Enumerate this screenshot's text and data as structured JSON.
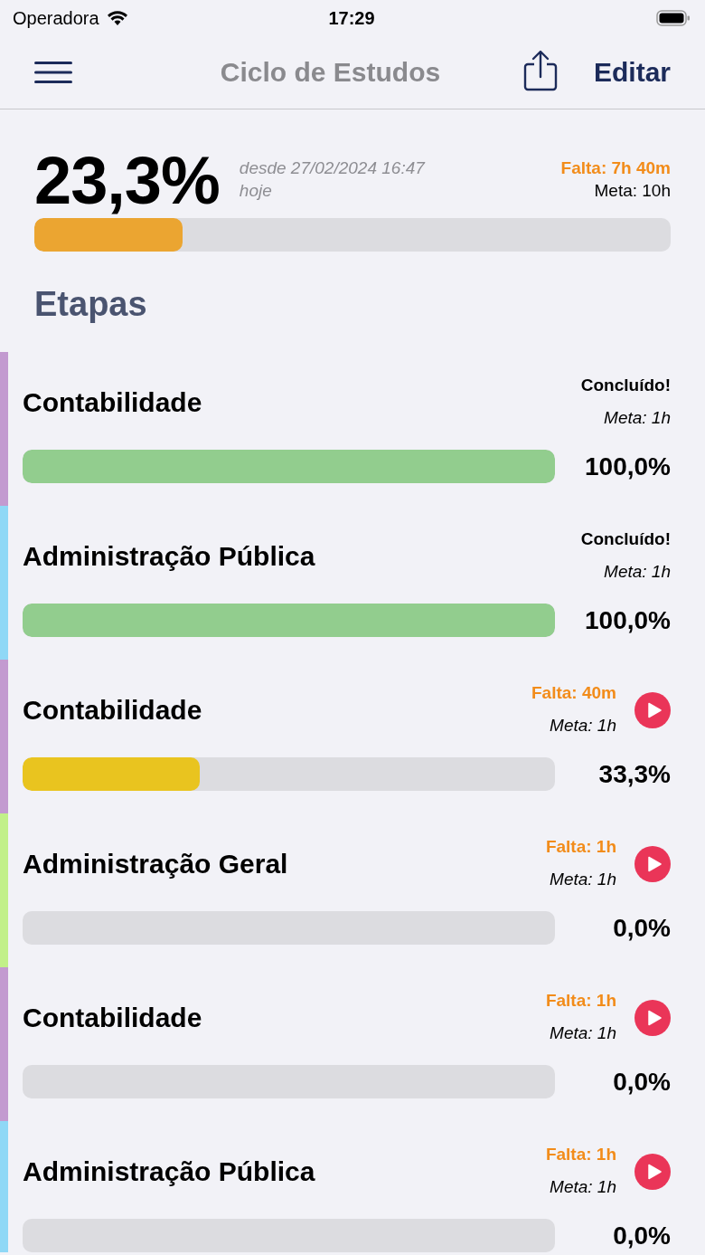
{
  "status_bar": {
    "carrier": "Operadora",
    "time": "17:29"
  },
  "nav": {
    "title": "Ciclo de Estudos",
    "edit": "Editar"
  },
  "summary": {
    "percent": "23,3%",
    "since": "desde 27/02/2024 16:47",
    "day": "hoje",
    "remaining": "Falta: 7h 40m",
    "goal": "Meta: 10h",
    "level": 0.233
  },
  "section_title": "Etapas",
  "stages": [
    {
      "color": "#c39ad0",
      "title": "Contabilidade",
      "status": {
        "kind": "done",
        "text": "Concluído!"
      },
      "goal": "Meta: 1h",
      "level": 1,
      "percent": "100,0%"
    },
    {
      "color": "#8fd8f6",
      "title": "Administração Pública",
      "status": {
        "kind": "done",
        "text": "Concluído!"
      },
      "goal": "Meta: 1h",
      "level": 1,
      "percent": "100,0%"
    },
    {
      "color": "#c39ad0",
      "title": "Contabilidade",
      "status": {
        "kind": "pending",
        "text": "Falta: 40m"
      },
      "goal": "Meta: 1h",
      "level": 0.333,
      "percent": "33,3%"
    },
    {
      "color": "#c2f089",
      "title": "Administração Geral",
      "status": {
        "kind": "pending",
        "text": "Falta: 1h"
      },
      "goal": "Meta: 1h",
      "level": 0,
      "percent": "0,0%"
    },
    {
      "color": "#c39ad0",
      "title": "Contabilidade",
      "status": {
        "kind": "pending",
        "text": "Falta: 1h"
      },
      "goal": "Meta: 1h",
      "level": 0,
      "percent": "0,0%"
    },
    {
      "color": "#8fd8f6",
      "title": "Administração Pública",
      "status": {
        "kind": "pending",
        "text": "Falta: 1h"
      },
      "goal": "Meta: 1h",
      "level": 0,
      "percent": "0,0%"
    }
  ]
}
